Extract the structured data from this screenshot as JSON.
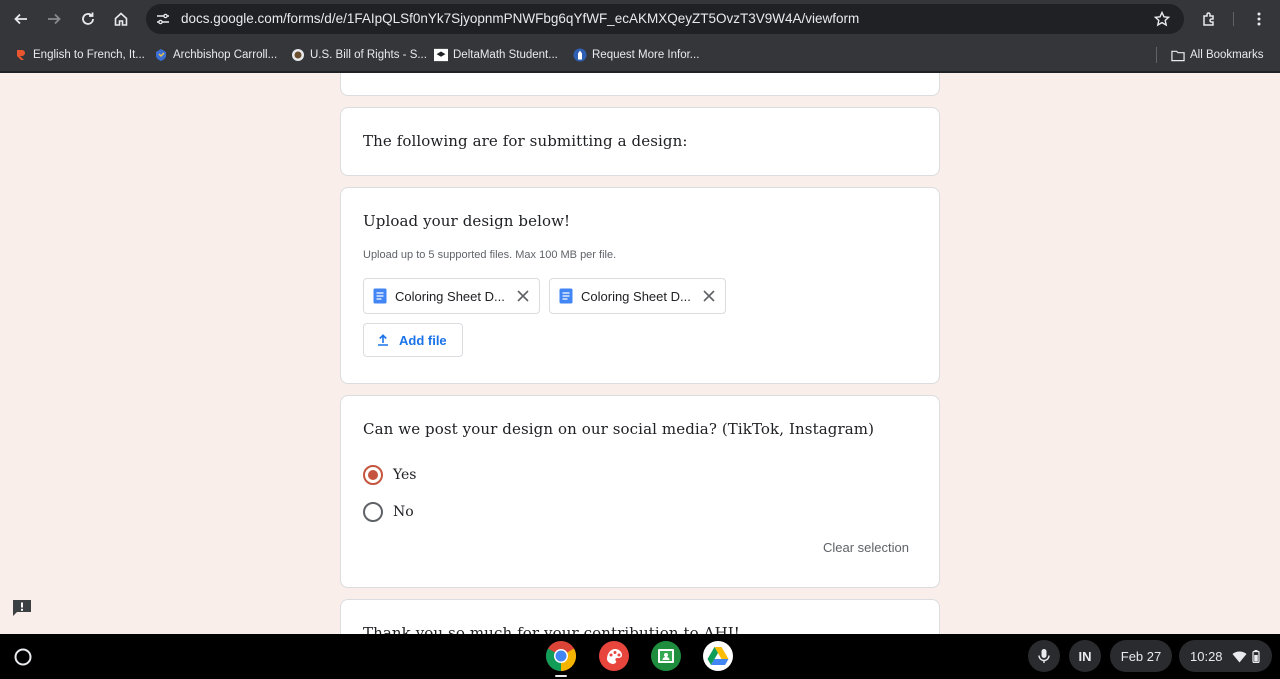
{
  "browser": {
    "url": "docs.google.com/forms/d/e/1FAIpQLSf0nYk7SjyopnmPNWFbg6qYfWF_ecAKMXQeyZT5OvzT3V9W4A/viewform",
    "bookmarks": [
      {
        "label": "English to French, It...",
        "icon": "reverso-icon"
      },
      {
        "label": "Archbishop Carroll...",
        "icon": "school-crest-icon"
      },
      {
        "label": "U.S. Bill of Rights - S...",
        "icon": "seal-icon"
      },
      {
        "label": "DeltaMath Student...",
        "icon": "deltamath-icon"
      },
      {
        "label": "Request More Infor...",
        "icon": "tower-icon"
      }
    ],
    "all_bookmarks": "All Bookmarks"
  },
  "form": {
    "section_text": "The following are for submitting a design:",
    "upload": {
      "title": "Upload your design below!",
      "hint": "Upload up to 5 supported files. Max 100 MB per file.",
      "files": [
        {
          "name": "Coloring Sheet D..."
        },
        {
          "name": "Coloring Sheet D..."
        }
      ],
      "add_label": "Add file"
    },
    "social": {
      "title": "Can we post your design on our social media? (TikTok, Instagram)",
      "options": [
        {
          "label": "Yes",
          "selected": true
        },
        {
          "label": "No",
          "selected": false
        }
      ],
      "clear_label": "Clear selection"
    },
    "next_card_text": "Thank you so much for your contribution to AHI!"
  },
  "shelf": {
    "input_method": "IN",
    "date": "Feb 27",
    "time": "10:28"
  },
  "colors": {
    "page_bg": "#faeeeb",
    "accent": "#c5553e",
    "link": "#1a73e8"
  }
}
